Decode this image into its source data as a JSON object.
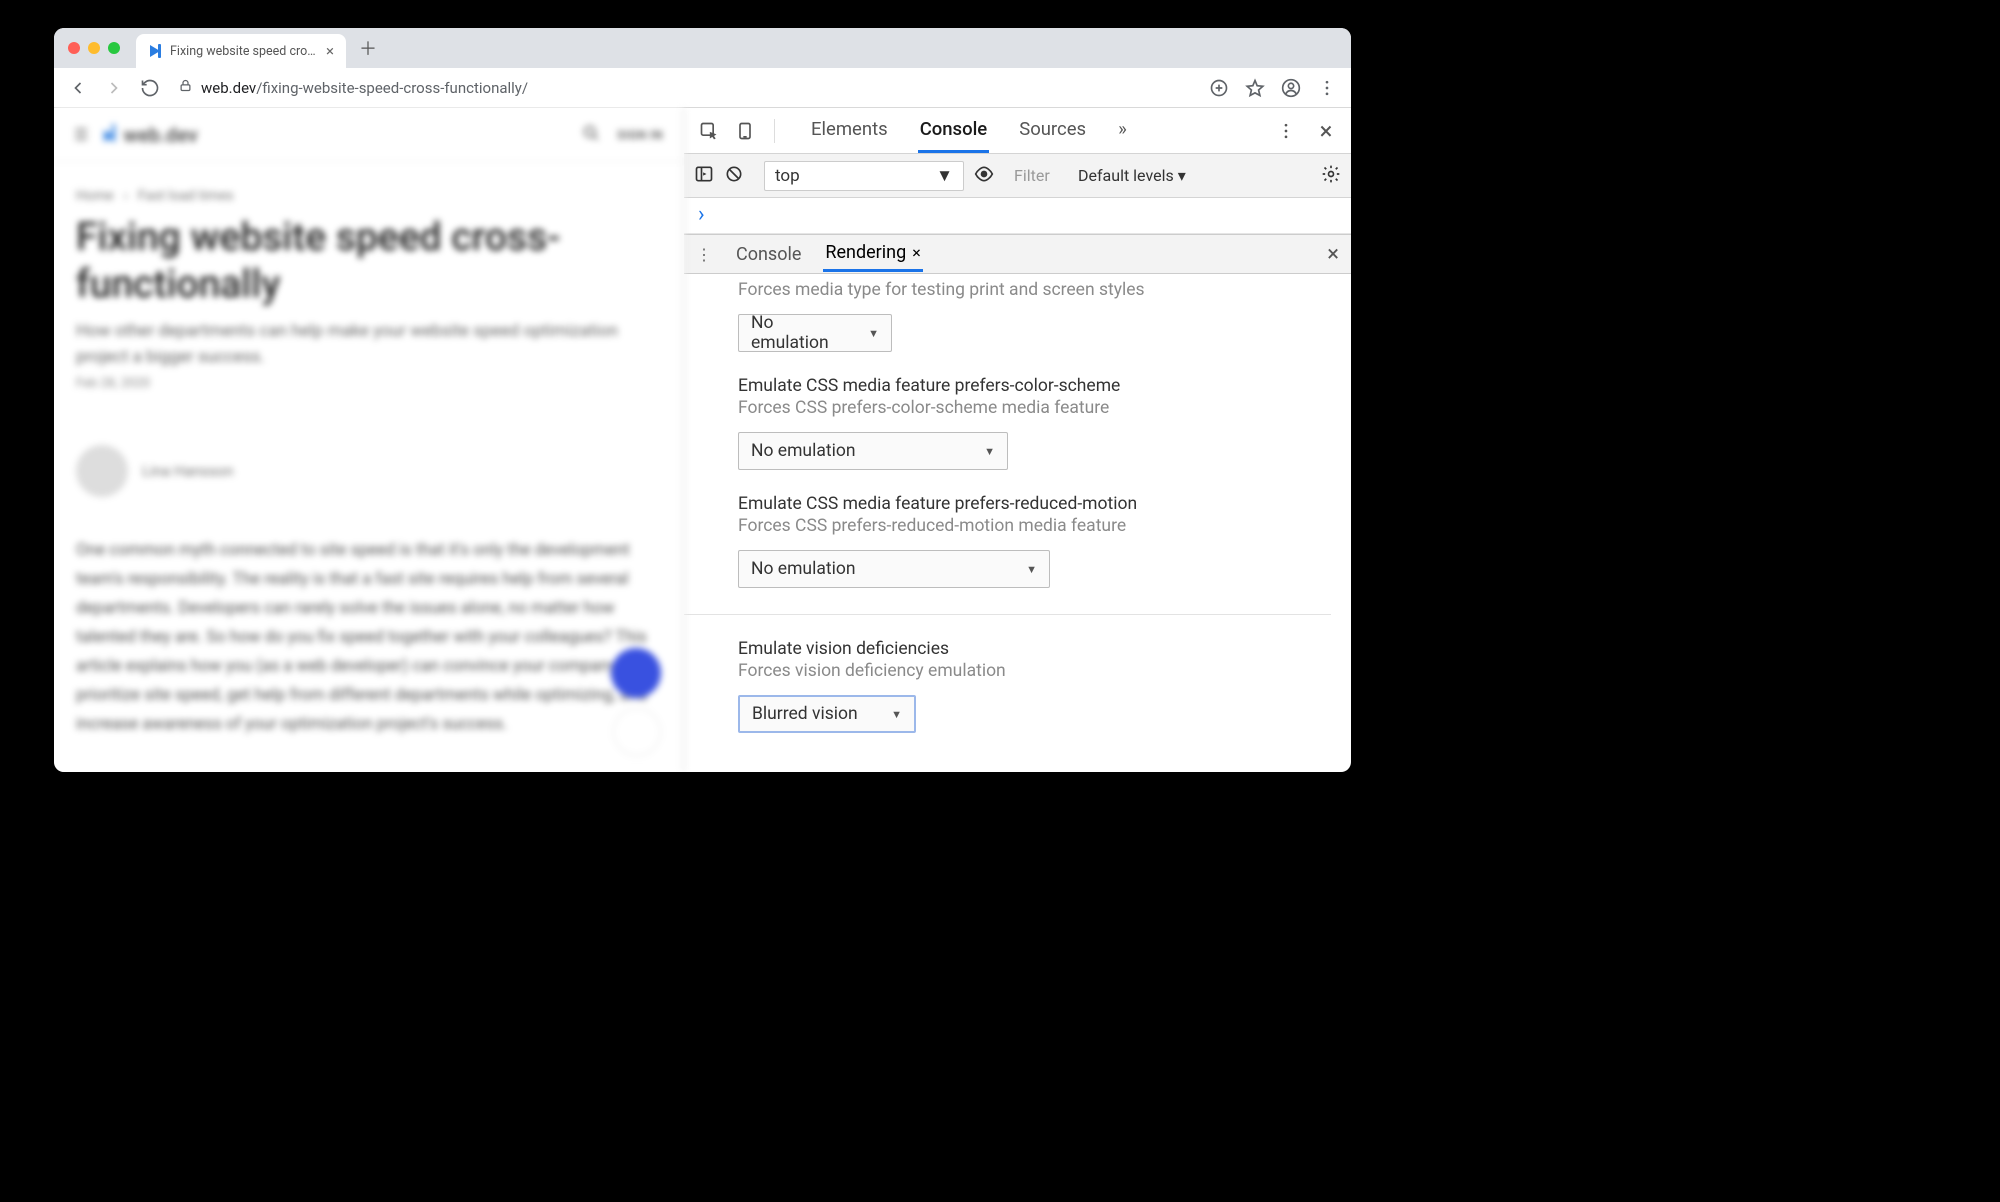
{
  "browser": {
    "tab_title": "Fixing website speed cross-fun",
    "url_domain": "web.dev",
    "url_path": "/fixing-website-speed-cross-functionally/"
  },
  "page": {
    "site_name": "web.dev",
    "signin": "SIGN IN",
    "breadcrumbs": {
      "a": "Home",
      "b": "Fast load times"
    },
    "title": "Fixing website speed cross-functionally",
    "subtitle": "How other departments can help make your website speed optimization project a bigger success.",
    "date": "Feb 28, 2020",
    "author": "Lina Hansson",
    "body": "One common myth connected to site speed is that it's only the development team's responsibility. The reality is that a fast site requires help from several departments. Developers can rarely solve the issues alone, no matter how talented they are. So how do you fix speed together with your colleagues? This article explains how you (as a web developer) can convince your company to prioritize site speed, get help from different departments while optimizing, and increase awareness of your optimization project's success."
  },
  "devtools": {
    "tabs": {
      "elements": "Elements",
      "console": "Console",
      "sources": "Sources"
    },
    "console_bar": {
      "context": "top",
      "filter_placeholder": "Filter",
      "levels": "Default levels ▾"
    },
    "drawer_tabs": {
      "console": "Console",
      "rendering": "Rendering"
    },
    "rendering": {
      "s0_sub": "Forces media type for testing print and screen styles",
      "s0_val": "No emulation",
      "s1_title": "Emulate CSS media feature prefers-color-scheme",
      "s1_sub": "Forces CSS prefers-color-scheme media feature",
      "s1_val": "No emulation",
      "s2_title": "Emulate CSS media feature prefers-reduced-motion",
      "s2_sub": "Forces CSS prefers-reduced-motion media feature",
      "s2_val": "No emulation",
      "s3_title": "Emulate vision deficiencies",
      "s3_sub": "Forces vision deficiency emulation",
      "s3_val": "Blurred vision"
    }
  }
}
